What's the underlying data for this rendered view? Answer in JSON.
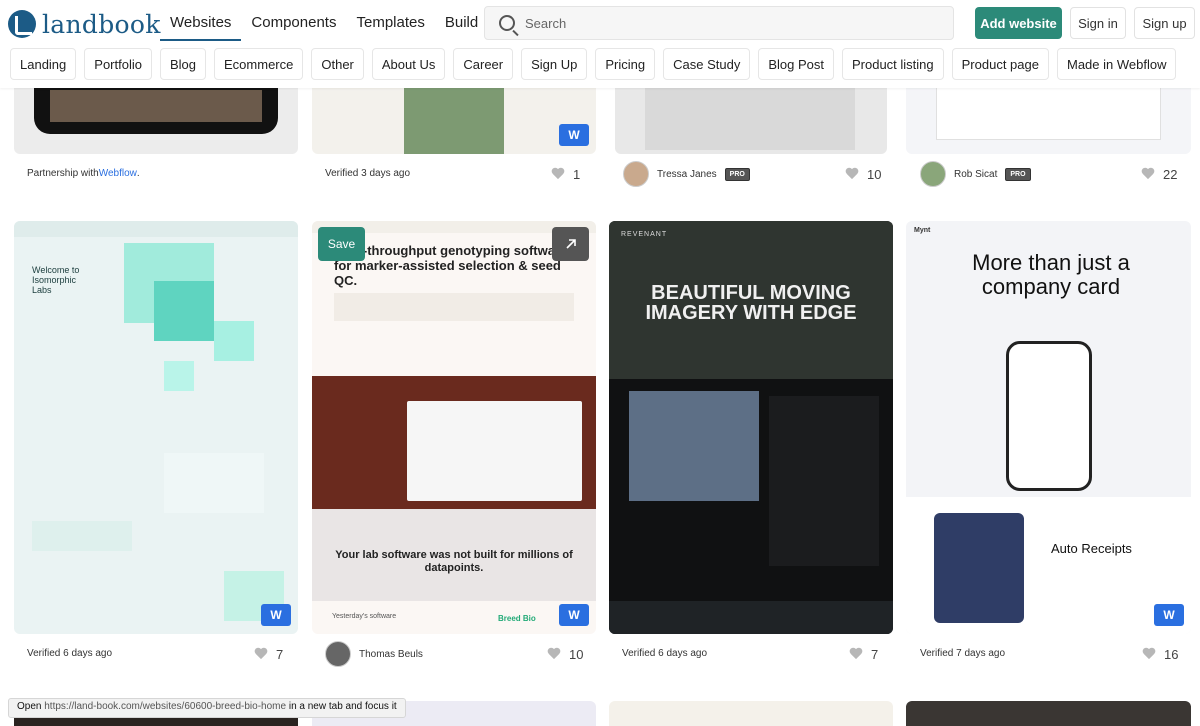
{
  "logo": {
    "text": "landbook"
  },
  "nav": [
    "Websites",
    "Components",
    "Templates",
    "Build"
  ],
  "search": {
    "placeholder": "Search"
  },
  "actions": {
    "add": "Add website",
    "sign_in": "Sign in",
    "sign_up": "Sign up"
  },
  "categories": [
    "Landing",
    "Portfolio",
    "Blog",
    "Ecommerce",
    "Other",
    "About Us",
    "Career",
    "Sign Up",
    "Pricing",
    "Case Study",
    "Blog Post",
    "Product listing",
    "Product page",
    "Made in Webflow"
  ],
  "top_row": [
    {
      "meta_prefix": "Partnership with ",
      "meta_link": "Webflow",
      "meta_suffix": "."
    },
    {
      "meta": "Verified 3 days ago",
      "likes": "1"
    },
    {
      "author": "Tressa Janes",
      "badge": "PRO",
      "likes": "10"
    },
    {
      "author": "Rob Sicat",
      "badge": "PRO",
      "likes": "22"
    }
  ],
  "cards": [
    {
      "meta": "Verified 6 days ago",
      "likes": "7",
      "shot": {
        "headline": "Welcome to Isomorphic Labs"
      }
    },
    {
      "author": "Thomas Beuls",
      "likes": "10",
      "save": "Save",
      "shot": {
        "headline": "High-throughput genotyping software for marker-assisted selection & seed QC.",
        "sub": "Your lab software was not built for millions of datapoints.",
        "logo": "Breed Bio",
        "footer": "Yesterday's software"
      }
    },
    {
      "meta": "Verified 6 days ago",
      "likes": "7",
      "shot": {
        "brand": "REVENANT",
        "headline": "BEAUTIFUL MOVING IMAGERY WITH EDGE"
      }
    },
    {
      "meta": "Verified 7 days ago",
      "likes": "16",
      "shot": {
        "brand": "Mynt",
        "headline": "More than just a company card",
        "sub": "Auto Receipts"
      }
    }
  ],
  "status_bar": {
    "open": "Open ",
    "url": "https://land-book.com/websites/60600-breed-bio-home",
    "rest": " in a new tab and focus it"
  },
  "colors": {
    "brand": "#1c5b86",
    "accent": "#2c8a79",
    "webflow": "#2a6fe0"
  }
}
